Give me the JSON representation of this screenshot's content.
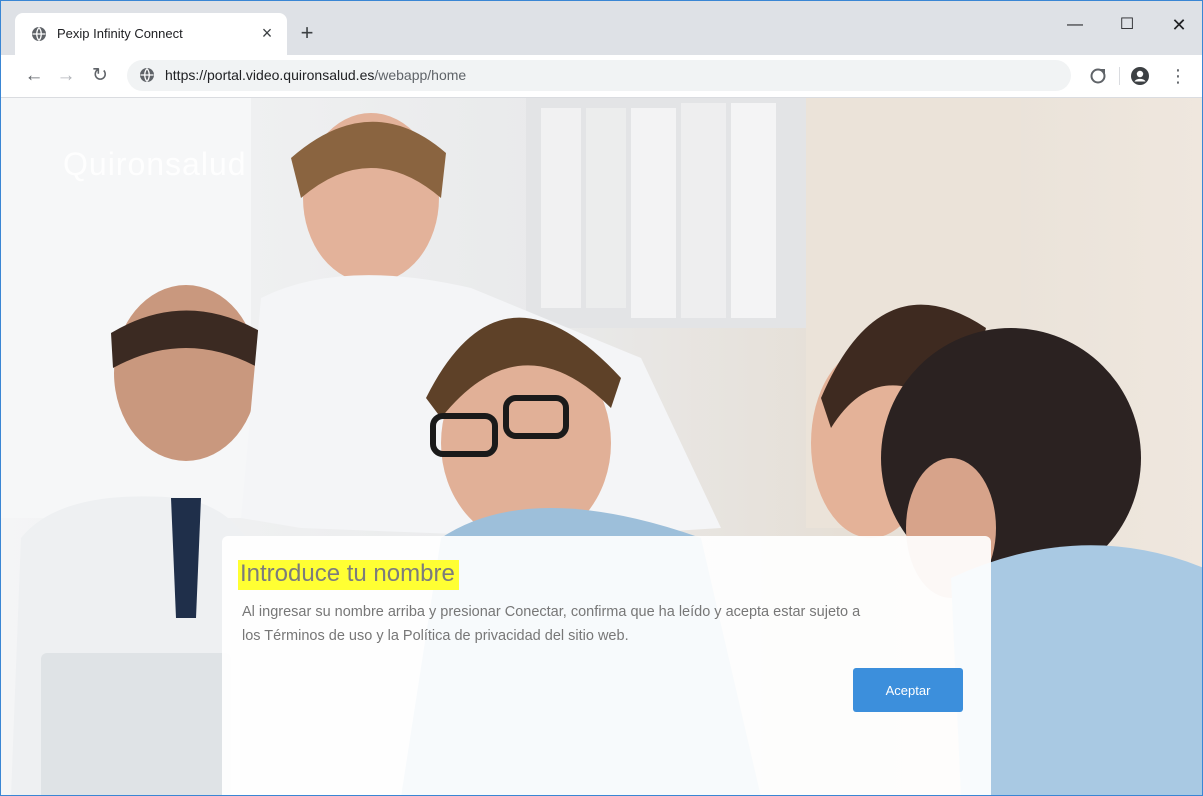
{
  "browser": {
    "tab_title": "Pexip Infinity Connect",
    "new_tab_label": "+",
    "url_host": "https://portal.video.quironsalud.es",
    "url_path": "/webapp/home"
  },
  "page": {
    "logo_text": "Quironsalud",
    "dialog": {
      "title": "Introduce tu nombre",
      "body": "Al ingresar su nombre arriba y presionar Conectar, confirma que ha leído y acepta estar sujeto a los Términos de uso y la Política de privacidad del sitio web.",
      "accept_label": "Aceptar"
    }
  },
  "colors": {
    "accept_button": "#3c8fdc",
    "title_highlight": "#ffff33",
    "tabstrip": "#dee1e6"
  },
  "icons": [
    "globe-icon",
    "close-icon",
    "minimize-icon",
    "maximize-icon",
    "back-arrow-icon",
    "forward-arrow-icon",
    "reload-icon",
    "extension-icon",
    "profile-icon",
    "menu-dots-icon"
  ]
}
